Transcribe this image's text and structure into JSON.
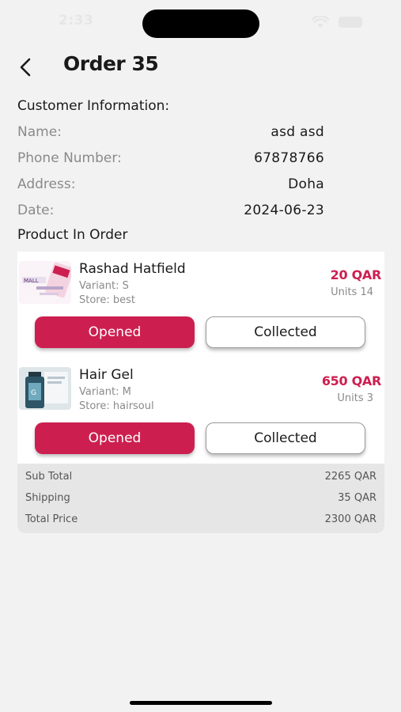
{
  "status_bar": {
    "time": "2:33"
  },
  "header": {
    "title": "Order 35"
  },
  "customer": {
    "section_title": "Customer Information:",
    "rows": [
      {
        "label": "Name:",
        "value": "asd asd"
      },
      {
        "label": "Phone Number:",
        "value": "67878766"
      },
      {
        "label": "Address:",
        "value": "Doha"
      },
      {
        "label": "Date:",
        "value": "2024-06-23"
      }
    ]
  },
  "products_section": {
    "title": "Product In Order"
  },
  "products": [
    {
      "name": "Rashad Hatfield",
      "variant": "Variant: S",
      "store": "Store: best",
      "price": "20 QAR",
      "units": "Units 14",
      "opened_label": "Opened",
      "collected_label": "Collected",
      "thumb": "mall-banner-thumbnail"
    },
    {
      "name": "Hair Gel",
      "variant": "Variant: M",
      "store": "Store: hairsoul",
      "price": "650 QAR",
      "units": "Units 3",
      "opened_label": "Opened",
      "collected_label": "Collected",
      "thumb": "hair-gel-bottle-thumbnail"
    }
  ],
  "totals": {
    "rows": [
      {
        "label": "Sub Total",
        "value": "2265 QAR"
      },
      {
        "label": "Shipping",
        "value": "35 QAR"
      },
      {
        "label": "Total Price",
        "value": "2300 QAR"
      }
    ]
  },
  "colors": {
    "accent": "#cc1f50",
    "background": "#f2f2f2",
    "card": "#ffffff",
    "totals_background": "#e6e6e6"
  }
}
